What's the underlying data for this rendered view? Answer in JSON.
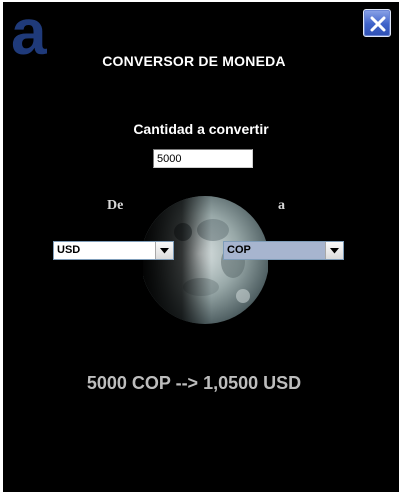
{
  "window": {
    "title": "CONVERSOR DE MONEDA",
    "close_icon": "close-icon"
  },
  "logo": {
    "icon": "logo-a-icon",
    "text": "a",
    "color": "#1f3a7a"
  },
  "form": {
    "amount_label": "Cantidad a convertir",
    "amount_value": "5000",
    "from_label": "De",
    "to_label": "a",
    "from_currency": "USD",
    "to_currency": "COP",
    "dropdown_icon": "chevron-down-icon"
  },
  "result": {
    "text": "5000 COP --> 1,0500 USD"
  },
  "colors": {
    "background": "#000000",
    "selected_select": "#a7b5cf",
    "close_button": "#3f63c9"
  }
}
